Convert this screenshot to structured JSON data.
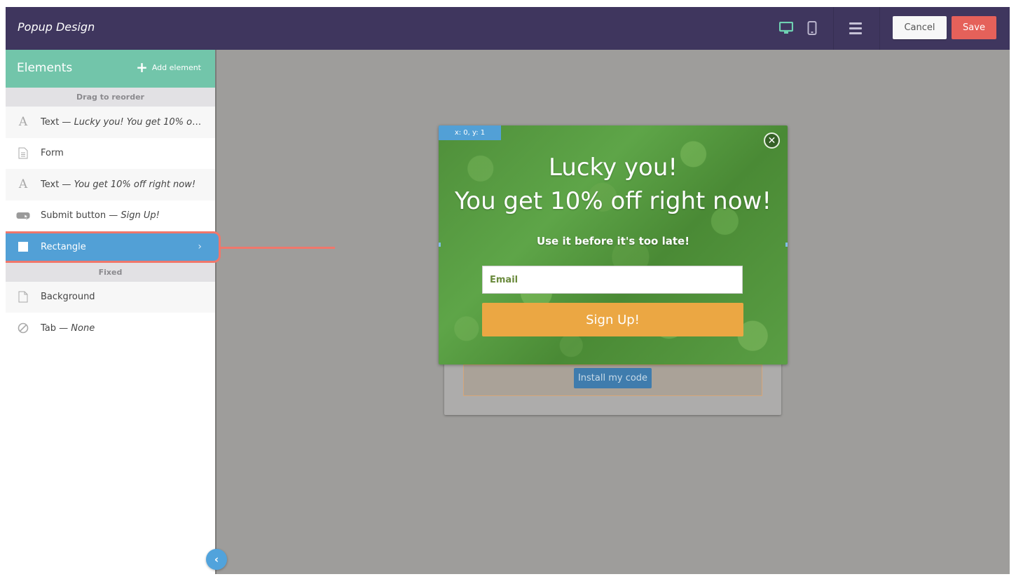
{
  "topbar": {
    "title": "Popup Design",
    "device_desktop_icon": "desktop-icon",
    "device_mobile_icon": "mobile-icon",
    "menu_icon": "hamburger-menu-icon",
    "cancel_label": "Cancel",
    "save_label": "Save",
    "colors": {
      "bar": "#3f365e",
      "save": "#e5615a",
      "desktop_active": "#6fd1b2"
    }
  },
  "sidebar": {
    "title": "Elements",
    "add_label": "Add element",
    "reorder_section": "Drag to reorder",
    "fixed_section": "Fixed",
    "items": [
      {
        "icon": "text-icon",
        "label": "Text — ",
        "detail": "Lucky you! You get 10% off ri..."
      },
      {
        "icon": "form-icon",
        "label": "Form",
        "detail": ""
      },
      {
        "icon": "text-icon",
        "label": "Text — ",
        "detail": "You get 10% off right now!"
      },
      {
        "icon": "submit-button-icon",
        "label": "Submit button — ",
        "detail": "Sign Up!"
      },
      {
        "icon": "rectangle-icon",
        "label": "Rectangle",
        "detail": "",
        "selected": true
      }
    ],
    "fixed_items": [
      {
        "icon": "page-icon",
        "label": "Background",
        "detail": ""
      },
      {
        "icon": "none-icon",
        "label": "Tab — ",
        "detail": "None"
      }
    ],
    "colors": {
      "header": "#72c5aa",
      "selected": "#52a0d6",
      "highlight_ring": "#f0776b"
    }
  },
  "canvas": {
    "position_badge": "x: 0, y: 1",
    "headline_line1": "Lucky you!",
    "headline_line2": "You get 10% off right now!",
    "subheadline": "Use it before it's too late!",
    "email_placeholder": "Email",
    "signup_label": "Sign Up!",
    "install_label": "Install my code",
    "colors": {
      "signup": "#eba743",
      "install": "#3f7cad"
    }
  }
}
